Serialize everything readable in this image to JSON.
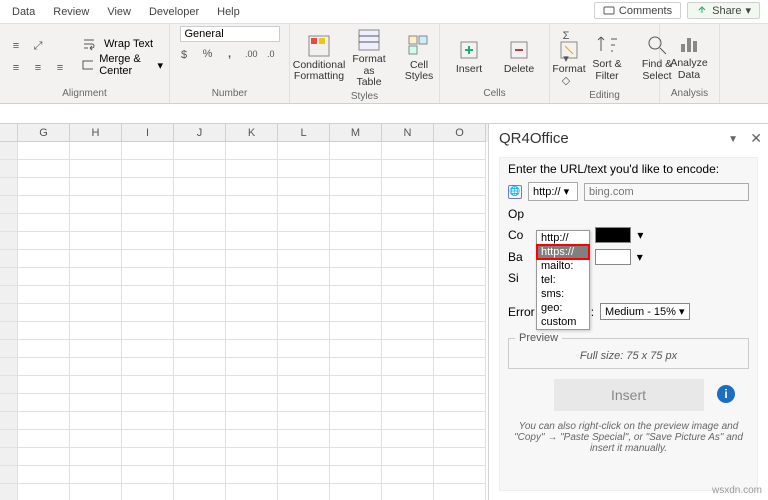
{
  "menu": {
    "m1": "Data",
    "m2": "Review",
    "m3": "View",
    "m4": "Developer",
    "m5": "Help"
  },
  "topbtn": {
    "comments": "Comments",
    "share": "Share"
  },
  "ribbon": {
    "alignment": {
      "wrap": "Wrap Text",
      "merge": "Merge & Center",
      "label": "Alignment"
    },
    "number": {
      "format": "General",
      "label": "Number"
    },
    "styles": {
      "cf": "Conditional\nFormatting",
      "ft": "Format as\nTable",
      "cs": "Cell\nStyles",
      "label": "Styles"
    },
    "cells": {
      "ins": "Insert",
      "del": "Delete",
      "fmt": "Format",
      "label": "Cells"
    },
    "editing": {
      "sort": "Sort &\nFilter",
      "find": "Find &\nSelect",
      "label": "Editing"
    },
    "analysis": {
      "ad": "Analyze\nData",
      "label": "Analysis"
    }
  },
  "cols": [
    "G",
    "H",
    "I",
    "J",
    "K",
    "L",
    "M",
    "N",
    "O"
  ],
  "pane": {
    "title": "QR4Office",
    "prompt": "Enter the URL/text you'd like to encode:",
    "scheme": "http://",
    "url_ph": "bing.com",
    "opts": [
      "http://",
      "https://",
      "mailto:",
      "tel:",
      "sms:",
      "geo:",
      "custom"
    ],
    "sel_idx": 1,
    "labels": {
      "op": "Op",
      "co": "Co",
      "ba": "Ba",
      "si": "Si"
    },
    "ec_label": "Error correction:",
    "ec_val": "Medium - 15%",
    "preview_label": "Preview",
    "preview_size": "Full size: 75 x 75 px",
    "insert": "Insert",
    "tip": "You can also right-click on the preview image and \"Copy\" → \"Paste Special\", or \"Save Picture As\" and insert it manually."
  },
  "watermark": "wsxdn.com"
}
